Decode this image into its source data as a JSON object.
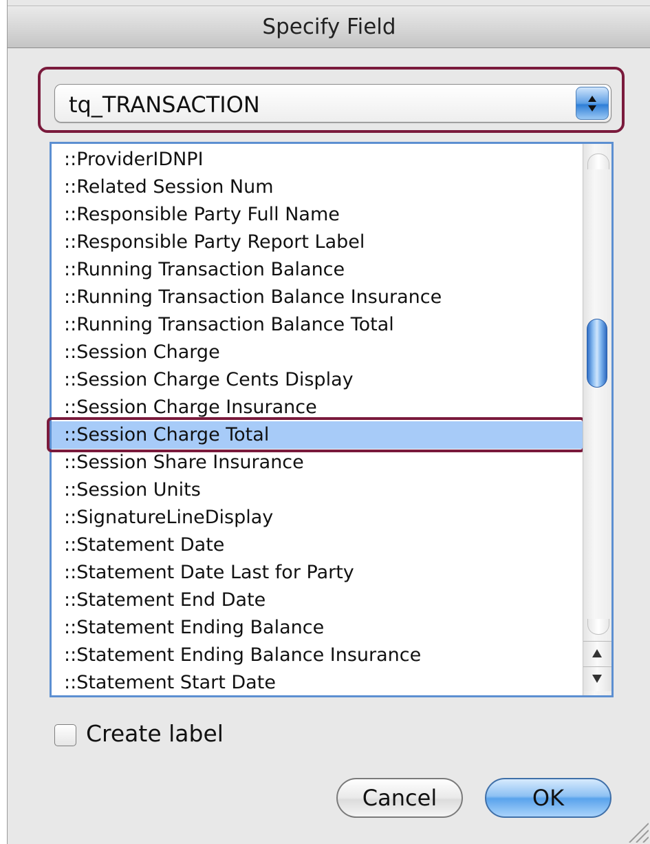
{
  "window": {
    "title": "Specify Field"
  },
  "table_popup": {
    "value": "tq_TRANSACTION"
  },
  "field_list": {
    "items": [
      "::ProviderIDNPI",
      "::Related Session Num",
      "::Responsible Party Full Name",
      "::Responsible Party Report Label",
      "::Running Transaction Balance",
      "::Running Transaction Balance Insurance",
      "::Running Transaction Balance Total",
      "::Session Charge",
      "::Session Charge Cents Display",
      "::Session Charge Insurance",
      "::Session Charge Total",
      "::Session Share Insurance",
      "::Session Units",
      "::SignatureLineDisplay",
      "::Statement Date",
      "::Statement Date Last for Party",
      "::Statement End Date",
      "::Statement Ending Balance",
      "::Statement Ending Balance Insurance",
      "::Statement Start Date"
    ],
    "selected": "::Session Charge Total"
  },
  "create_label": {
    "label": "Create label",
    "checked": false
  },
  "buttons": {
    "cancel": "Cancel",
    "ok": "OK"
  },
  "colors": {
    "selection": "#a7cbf8",
    "highlight_outline": "#7a1a3c",
    "list_border": "#5c8fd1",
    "default_button": "#5aa3ec"
  },
  "icons": {
    "popup_stepper": "up-down-arrows-icon",
    "scroll_up": "triangle-up-icon",
    "scroll_down": "triangle-down-icon",
    "resize_grip": "resize-grip-icon"
  }
}
